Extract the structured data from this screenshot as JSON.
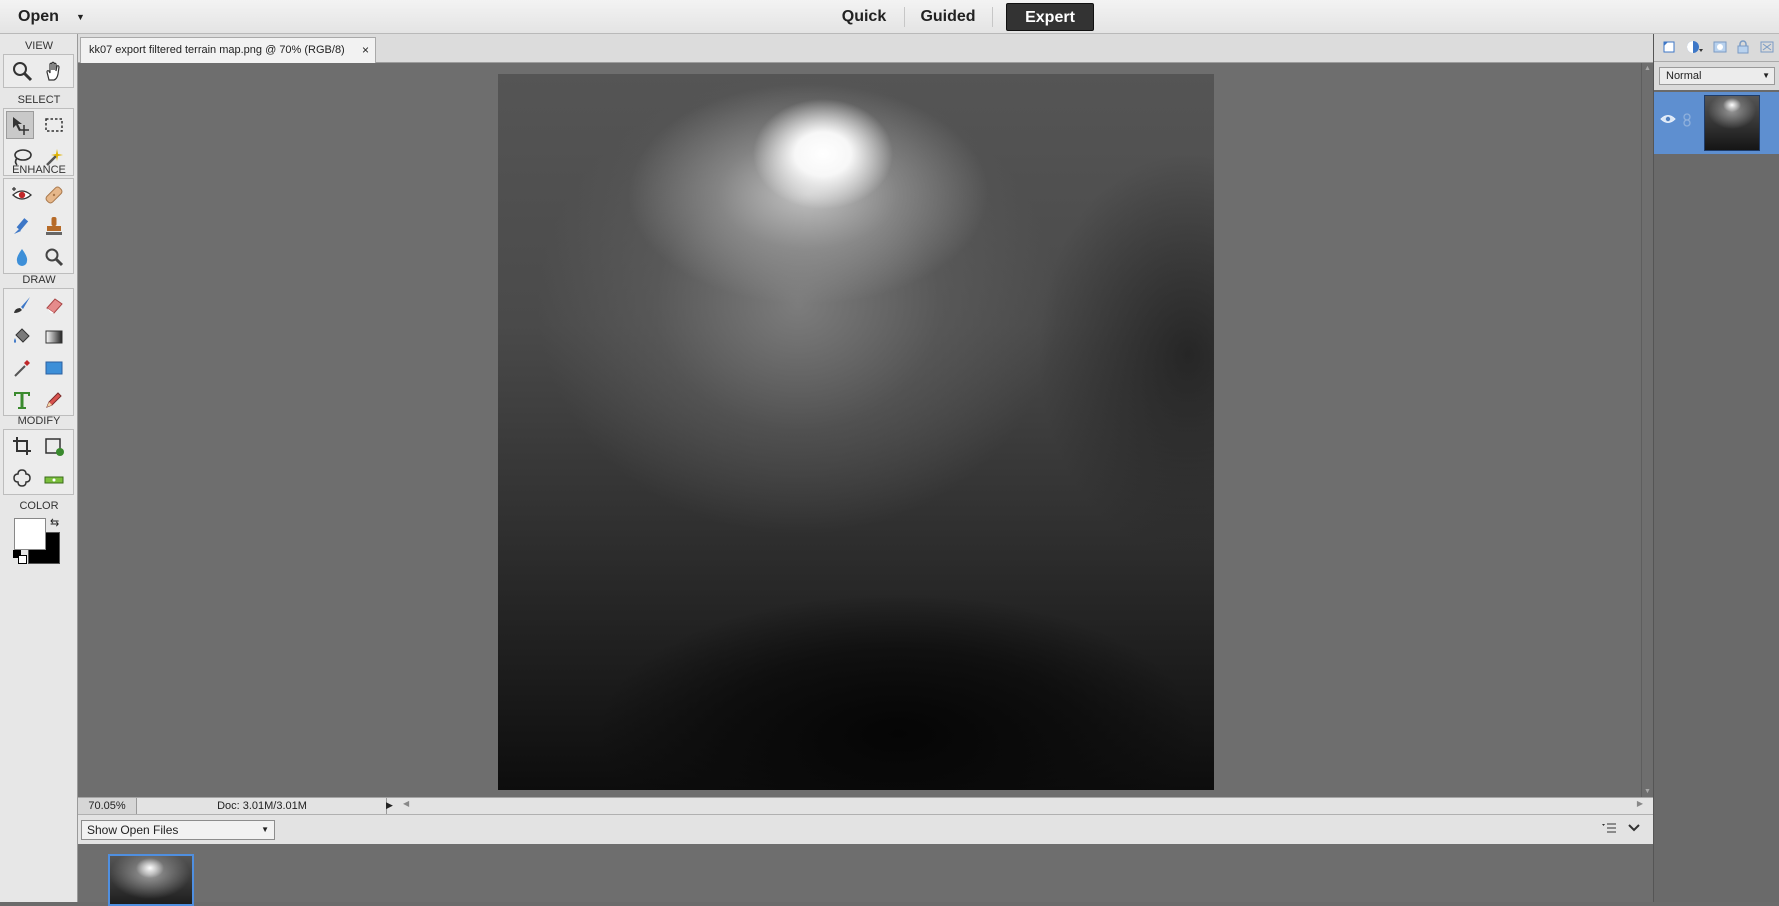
{
  "topbar": {
    "open_label": "Open",
    "modes": [
      {
        "label": "Quick",
        "active": false
      },
      {
        "label": "Guided",
        "active": false
      },
      {
        "label": "Expert",
        "active": true
      }
    ]
  },
  "toolbox": {
    "sections": {
      "view": "VIEW",
      "select": "SELECT",
      "enhance": "ENHANCE",
      "draw": "DRAW",
      "modify": "MODIFY",
      "color": "COLOR"
    },
    "tools": {
      "view": [
        "zoom-tool",
        "hand-tool"
      ],
      "select": [
        "move-tool",
        "rectangular-marquee-tool",
        "lasso-tool",
        "magic-wand-tool"
      ],
      "enhance": [
        "red-eye-tool",
        "healing-brush-tool",
        "smart-brush-tool",
        "clone-stamp-tool",
        "blur-tool",
        "sponge-tool"
      ],
      "draw": [
        "brush-tool",
        "eraser-tool",
        "paint-bucket-tool",
        "gradient-tool",
        "eyedropper-tool",
        "shape-tool",
        "type-tool",
        "pencil-tool"
      ],
      "modify": [
        "crop-tool",
        "recompose-tool",
        "content-aware-move-tool",
        "straighten-tool"
      ]
    },
    "colors": {
      "foreground": "#ffffff",
      "background": "#000000"
    }
  },
  "document": {
    "tab_title": "kk07 export filtered terrain map.png @ 70% (RGB/8)",
    "close_glyph": "×"
  },
  "status": {
    "zoom": "70.05%",
    "doc_info": "Doc: 3.01M/3.01M"
  },
  "photo_bin": {
    "select_value": "Show Open Files"
  },
  "layers": {
    "blend_mode": "Normal"
  },
  "colors": {
    "accent": "#5e8fd0",
    "mode_active_bg": "#333333"
  }
}
